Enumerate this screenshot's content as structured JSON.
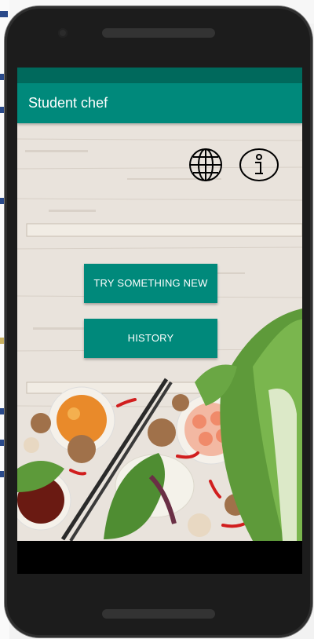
{
  "app": {
    "title": "Student chef"
  },
  "actions": {
    "try_label": "TRY SOMETHING NEW",
    "history_label": "HISTORY"
  },
  "icons": {
    "language": "globe-icon",
    "info": "info-icon"
  },
  "colors": {
    "status_bar": "#00695c",
    "app_bar": "#00897b",
    "button": "#00897b",
    "button_text": "#ffffff"
  }
}
